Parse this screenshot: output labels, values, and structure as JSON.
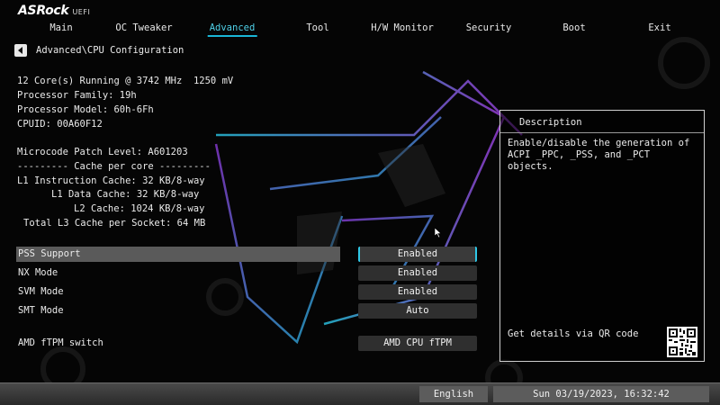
{
  "brand": {
    "name": "ASRock",
    "sub": "UEFI"
  },
  "nav": [
    {
      "label": "Main",
      "active": false
    },
    {
      "label": "OC Tweaker",
      "active": false
    },
    {
      "label": "Advanced",
      "active": true
    },
    {
      "label": "Tool",
      "active": false
    },
    {
      "label": "H/W Monitor",
      "active": false
    },
    {
      "label": "Security",
      "active": false
    },
    {
      "label": "Boot",
      "active": false
    },
    {
      "label": "Exit",
      "active": false
    }
  ],
  "breadcrumb": "Advanced\\CPU Configuration",
  "info": {
    "cores": "12 Core(s) Running @ 3742 MHz  1250 mV",
    "family": "Processor Family: 19h",
    "model": "Processor Model: 60h-6Fh",
    "cpuid": "CPUID: 00A60F12",
    "microcode": "Microcode Patch Level: A601203",
    "cache_header": "--------- Cache per core ---------",
    "l1i": "L1 Instruction Cache: 32 KB/8-way",
    "l1d": "L1 Data Cache: 32 KB/8-way",
    "l2": "L2 Cache: 1024 KB/8-way",
    "l3": "Total L3 Cache per Socket: 64 MB"
  },
  "settings": [
    {
      "label": "PSS Support",
      "value": "Enabled",
      "selected": true
    },
    {
      "label": "NX Mode",
      "value": "Enabled",
      "selected": false
    },
    {
      "label": "SVM Mode",
      "value": "Enabled",
      "selected": false
    },
    {
      "label": "SMT Mode",
      "value": "Auto",
      "selected": false
    },
    {
      "label": "AMD fTPM switch",
      "value": "AMD CPU fTPM",
      "selected": false
    }
  ],
  "description": {
    "title": "Description",
    "body": "Enable/disable the generation of ACPI _PPC, _PSS, and _PCT objects.",
    "qr_text": "Get details via QR code"
  },
  "bottom": {
    "language": "English",
    "datetime": "Sun 03/19/2023, 16:32:42"
  },
  "colors": {
    "accent": "#19b6d6",
    "selected_row": "#5a5a5a",
    "value_box": "#2f2f2f"
  }
}
